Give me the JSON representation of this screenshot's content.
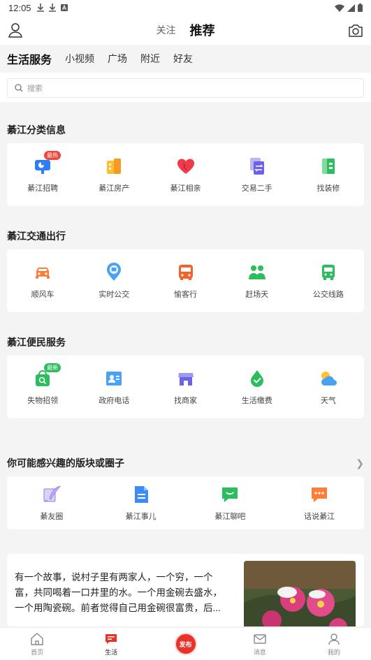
{
  "status_bar": {
    "time": "12:05"
  },
  "header": {
    "tabs": [
      {
        "label": "关注"
      },
      {
        "label": "推荐"
      }
    ]
  },
  "sub_tabs": [
    {
      "label": "生活服务"
    },
    {
      "label": "小视频"
    },
    {
      "label": "广场"
    },
    {
      "label": "附近"
    },
    {
      "label": "好友"
    }
  ],
  "search": {
    "placeholder": "搜索"
  },
  "sections": [
    {
      "title": "綦江分类信息",
      "items": [
        {
          "label": "綦江招聘",
          "icon": "presentation-icon",
          "badge": "最热"
        },
        {
          "label": "綦江房产",
          "icon": "building-icon"
        },
        {
          "label": "綦江相亲",
          "icon": "heart-icon"
        },
        {
          "label": "交易二手",
          "icon": "exchange-icon"
        },
        {
          "label": "找装修",
          "icon": "paint-icon"
        }
      ]
    },
    {
      "title": "綦江交通出行",
      "items": [
        {
          "label": "顺风车",
          "icon": "car-icon"
        },
        {
          "label": "实时公交",
          "icon": "bus-stop-icon"
        },
        {
          "label": "愉客行",
          "icon": "coach-icon"
        },
        {
          "label": "赶场天",
          "icon": "people-icon"
        },
        {
          "label": "公交线路",
          "icon": "bus-icon"
        }
      ]
    },
    {
      "title": "綦江便民服务",
      "items": [
        {
          "label": "失物招领",
          "icon": "lost-found-icon",
          "badge": "最新"
        },
        {
          "label": "政府电话",
          "icon": "contact-card-icon"
        },
        {
          "label": "找商家",
          "icon": "store-icon"
        },
        {
          "label": "生活缴费",
          "icon": "water-drop-icon"
        },
        {
          "label": "天气",
          "icon": "weather-icon"
        }
      ]
    },
    {
      "title": "你可能感兴趣的版块或圈子",
      "items": [
        {
          "label": "綦友圈",
          "icon": "quill-icon"
        },
        {
          "label": "綦江事儿",
          "icon": "document-icon"
        },
        {
          "label": "綦江聊吧",
          "icon": "chat-smile-icon"
        },
        {
          "label": "话说綦江",
          "icon": "speech-icon"
        }
      ]
    }
  ],
  "article": {
    "text": "有一个故事，说村子里有两家人，一个穷，一个富，共同喝着一口井里的水。一个用金碗去盛水，一个用陶瓷碗。前者觉得自己用金碗很富贵，后..."
  },
  "bottom_nav": [
    {
      "label": "首页",
      "icon": "home-icon"
    },
    {
      "label": "生活",
      "icon": "life-chat-icon"
    },
    {
      "label": "发布",
      "icon": "post-icon"
    },
    {
      "label": "消息",
      "icon": "mail-icon"
    },
    {
      "label": "我的",
      "icon": "profile-icon"
    }
  ],
  "colors": {
    "accent": "#e83b2e",
    "background": "#f4f4f4"
  }
}
